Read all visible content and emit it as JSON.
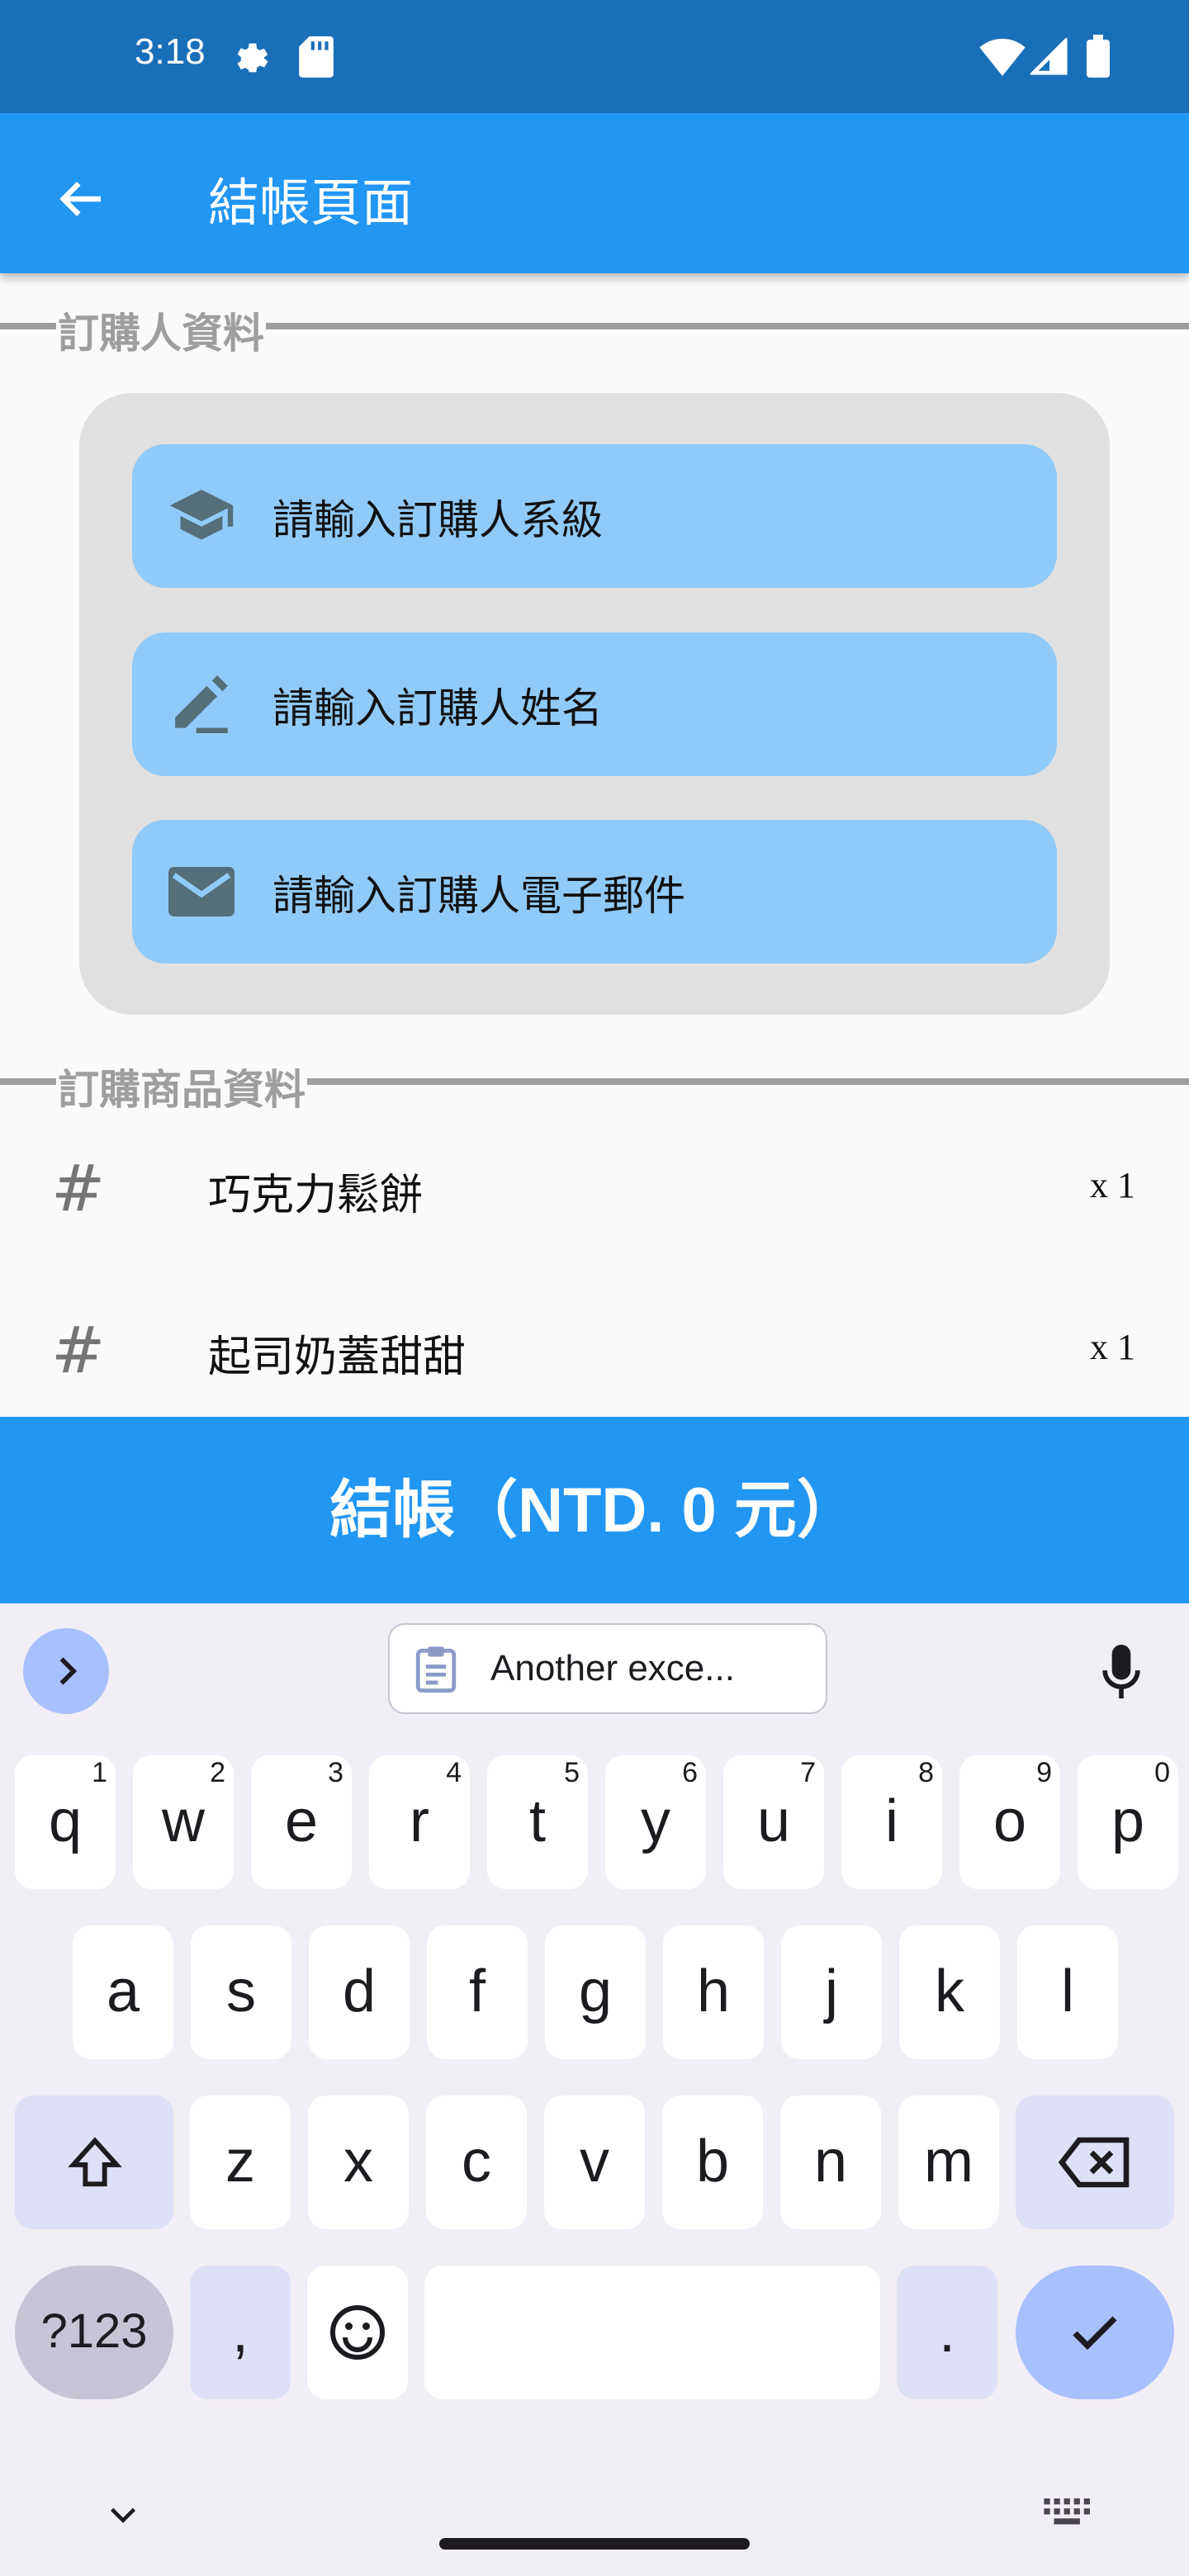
{
  "status_bar": {
    "time": "3:18"
  },
  "app_bar": {
    "title": "結帳頁面",
    "back_icon": "arrow-left-icon"
  },
  "buyer_section": {
    "label": "訂購人資料",
    "fields": [
      {
        "icon": "graduation-cap-icon",
        "placeholder": "請輸入訂購人系級"
      },
      {
        "icon": "pencil-icon",
        "placeholder": "請輸入訂購人姓名"
      },
      {
        "icon": "envelope-icon",
        "placeholder": "請輸入訂購人電子郵件"
      }
    ]
  },
  "items_section": {
    "label": "訂購商品資料",
    "items": [
      {
        "icon": "#",
        "name": "巧克力鬆餅",
        "qty": "x 1"
      },
      {
        "icon": "#",
        "name": "起司奶蓋甜甜",
        "qty": "x 1"
      }
    ]
  },
  "checkout_button": {
    "label": "結帳（NTD. 0 元）"
  },
  "keyboard": {
    "suggestion": "Another exce...",
    "row1": [
      "q",
      "w",
      "e",
      "r",
      "t",
      "y",
      "u",
      "i",
      "o",
      "p"
    ],
    "row1_nums": [
      "1",
      "2",
      "3",
      "4",
      "5",
      "6",
      "7",
      "8",
      "9",
      "0"
    ],
    "row2": [
      "a",
      "s",
      "d",
      "f",
      "g",
      "h",
      "j",
      "k",
      "l"
    ],
    "row3": [
      "z",
      "x",
      "c",
      "v",
      "b",
      "n",
      "m"
    ],
    "symbols_key": "?123",
    "comma_key": ",",
    "period_key": "."
  }
}
